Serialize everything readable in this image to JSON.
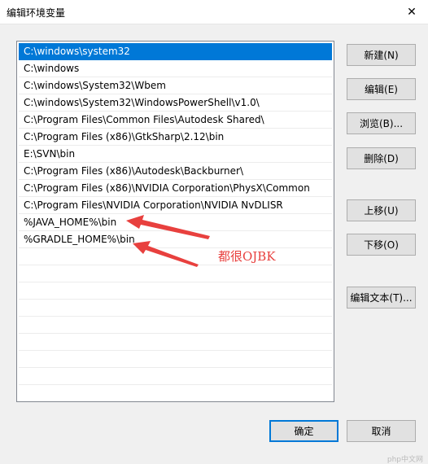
{
  "window": {
    "title": "编辑环境变量",
    "close_glyph": "✕"
  },
  "list": {
    "items": [
      {
        "text": "C:\\windows\\system32",
        "selected": true
      },
      {
        "text": "C:\\windows",
        "selected": false
      },
      {
        "text": "C:\\windows\\System32\\Wbem",
        "selected": false
      },
      {
        "text": "C:\\windows\\System32\\WindowsPowerShell\\v1.0\\",
        "selected": false
      },
      {
        "text": "C:\\Program Files\\Common Files\\Autodesk Shared\\",
        "selected": false
      },
      {
        "text": "C:\\Program Files (x86)\\GtkSharp\\2.12\\bin",
        "selected": false
      },
      {
        "text": "E:\\SVN\\bin",
        "selected": false
      },
      {
        "text": "C:\\Program Files (x86)\\Autodesk\\Backburner\\",
        "selected": false
      },
      {
        "text": "C:\\Program Files (x86)\\NVIDIA Corporation\\PhysX\\Common",
        "selected": false
      },
      {
        "text": "C:\\Program Files\\NVIDIA Corporation\\NVIDIA NvDLISR",
        "selected": false
      },
      {
        "text": "%JAVA_HOME%\\bin",
        "selected": false
      },
      {
        "text": "%GRADLE_HOME%\\bin",
        "selected": false
      }
    ]
  },
  "buttons": {
    "new": "新建(N)",
    "edit": "编辑(E)",
    "browse": "浏览(B)...",
    "delete": "删除(D)",
    "move_up": "上移(U)",
    "move_down": "下移(O)",
    "edit_text": "编辑文本(T)...",
    "ok": "确定",
    "cancel": "取消"
  },
  "annotation": {
    "text": "都很OJBK",
    "color": "#e8403e"
  },
  "watermark": "php中文网",
  "colors": {
    "selection": "#0078d7",
    "annotation_red": "#e8403e"
  }
}
